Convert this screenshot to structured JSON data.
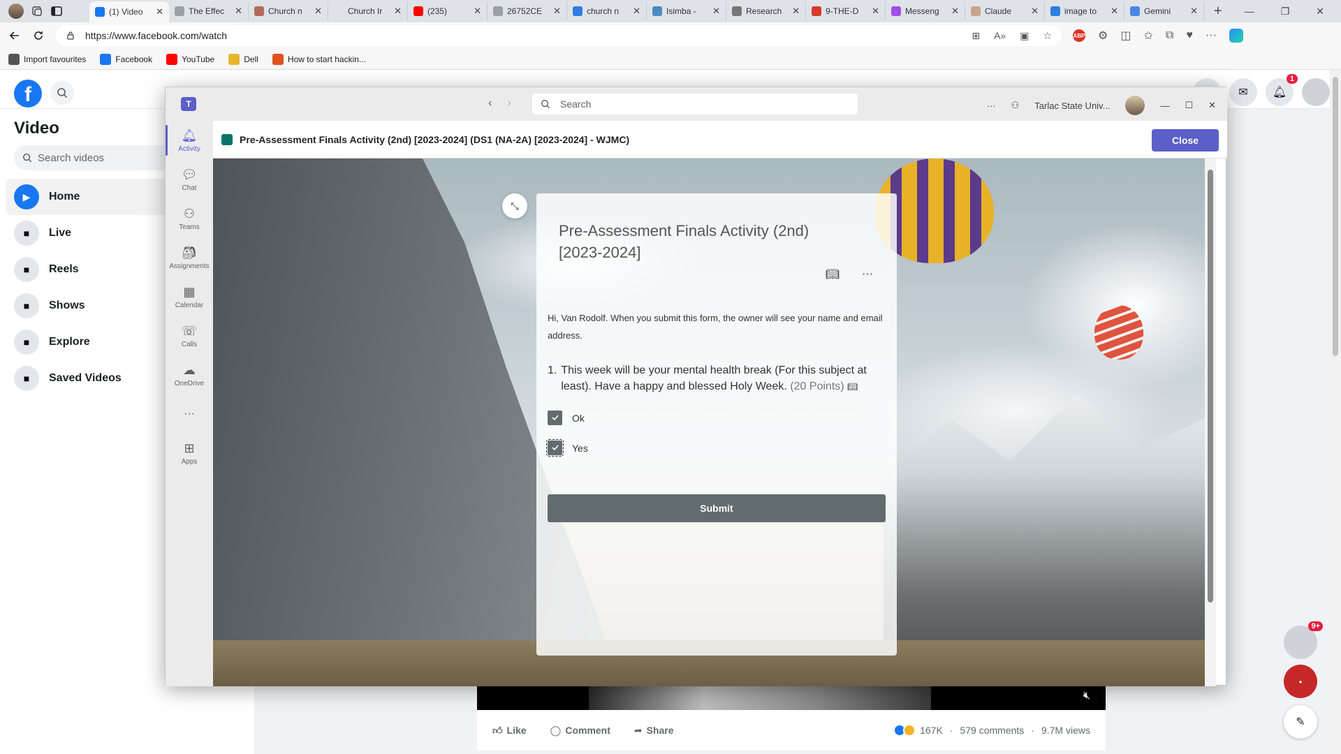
{
  "browser": {
    "tabs": [
      {
        "title": "(1) Video",
        "favicon_color": "#1877f2",
        "active": true
      },
      {
        "title": "The Effec",
        "favicon_color": "#9aa0a6"
      },
      {
        "title": "Church n",
        "favicon_color": "#b26b5a"
      },
      {
        "title": "Church Ir",
        "favicon_color": "#dfe3e8"
      },
      {
        "title": "(235)",
        "favicon_color": "#ff0000"
      },
      {
        "title": "26752CE",
        "favicon_color": "#9aa0a6"
      },
      {
        "title": "church n",
        "favicon_color": "#2f7de1"
      },
      {
        "title": "Isimba -",
        "favicon_color": "#4a8cc2"
      },
      {
        "title": "Research",
        "favicon_color": "#777777"
      },
      {
        "title": "9-THE-D",
        "favicon_color": "#d33b2c"
      },
      {
        "title": "Messeng",
        "favicon_color": "#a04fe8"
      },
      {
        "title": "Claude",
        "favicon_color": "#c9a489"
      },
      {
        "title": "image to",
        "favicon_color": "#2f7de1"
      },
      {
        "title": "Gemini",
        "favicon_color": "#4a86e8"
      }
    ],
    "url": "https://www.facebook.com/watch",
    "favorites": [
      {
        "label": "Import favourites",
        "icon": "import-icon",
        "color": "#555555"
      },
      {
        "label": "Facebook",
        "icon": "facebook-icon",
        "color": "#1877f2"
      },
      {
        "label": "YouTube",
        "icon": "youtube-icon",
        "color": "#ff0000"
      },
      {
        "label": "Dell",
        "icon": "folder-icon",
        "color": "#e8b530"
      },
      {
        "label": "How to start hackin...",
        "icon": "site-icon",
        "color": "#e0531f"
      }
    ]
  },
  "facebook": {
    "page_title": "Video",
    "search_placeholder": "Search videos",
    "nav": [
      {
        "label": "Home",
        "icon": "play-icon",
        "active": true
      },
      {
        "label": "Live",
        "icon": "live-icon"
      },
      {
        "label": "Reels",
        "icon": "reels-icon"
      },
      {
        "label": "Shows",
        "icon": "shows-icon"
      },
      {
        "label": "Explore",
        "icon": "explore-icon"
      },
      {
        "label": "Saved Videos",
        "icon": "bookmark-icon"
      }
    ],
    "notification_count": "1",
    "chat_badge": "9+",
    "video_actions": {
      "like": "Like",
      "comment": "Comment",
      "share": "Share"
    },
    "video_stats": {
      "reactions": "167K",
      "comments": "579 comments",
      "views": "9.7M views"
    },
    "reaction_colors": [
      "#1877f2",
      "#f7b125"
    ]
  },
  "teams": {
    "search_placeholder": "Search",
    "org": "Tarlac State Univ...",
    "rail": [
      {
        "label": "Activity",
        "icon": "bell-icon",
        "active": true
      },
      {
        "label": "Chat",
        "icon": "chat-icon"
      },
      {
        "label": "Teams",
        "icon": "teams-icon"
      },
      {
        "label": "Assignments",
        "icon": "assignments-icon"
      },
      {
        "label": "Calendar",
        "icon": "calendar-icon"
      },
      {
        "label": "Calls",
        "icon": "phone-icon"
      },
      {
        "label": "OneDrive",
        "icon": "cloud-icon"
      },
      {
        "label": "Apps",
        "icon": "apps-icon"
      }
    ],
    "accent": "#5b5fc7",
    "header_title": "Pre-Assessment Finals Activity (2nd) [2023-2024] (DS1 (NA-2A) [2023-2024] - WJMC)",
    "close_label": "Close"
  },
  "form": {
    "title": "Pre-Assessment Finals Activity (2nd) [2023-2024]",
    "intro": "Hi, Van Rodolf. When you submit this form, the owner will see your name and email address.",
    "question_number": "1.",
    "question_text": "This week will be your mental health break (For this subject at least). Have a happy and blessed Holy Week.",
    "question_points": "(20 Points)",
    "options": [
      {
        "label": "Ok",
        "checked": true
      },
      {
        "label": "Yes",
        "checked": true
      }
    ],
    "submit_label": "Submit"
  }
}
